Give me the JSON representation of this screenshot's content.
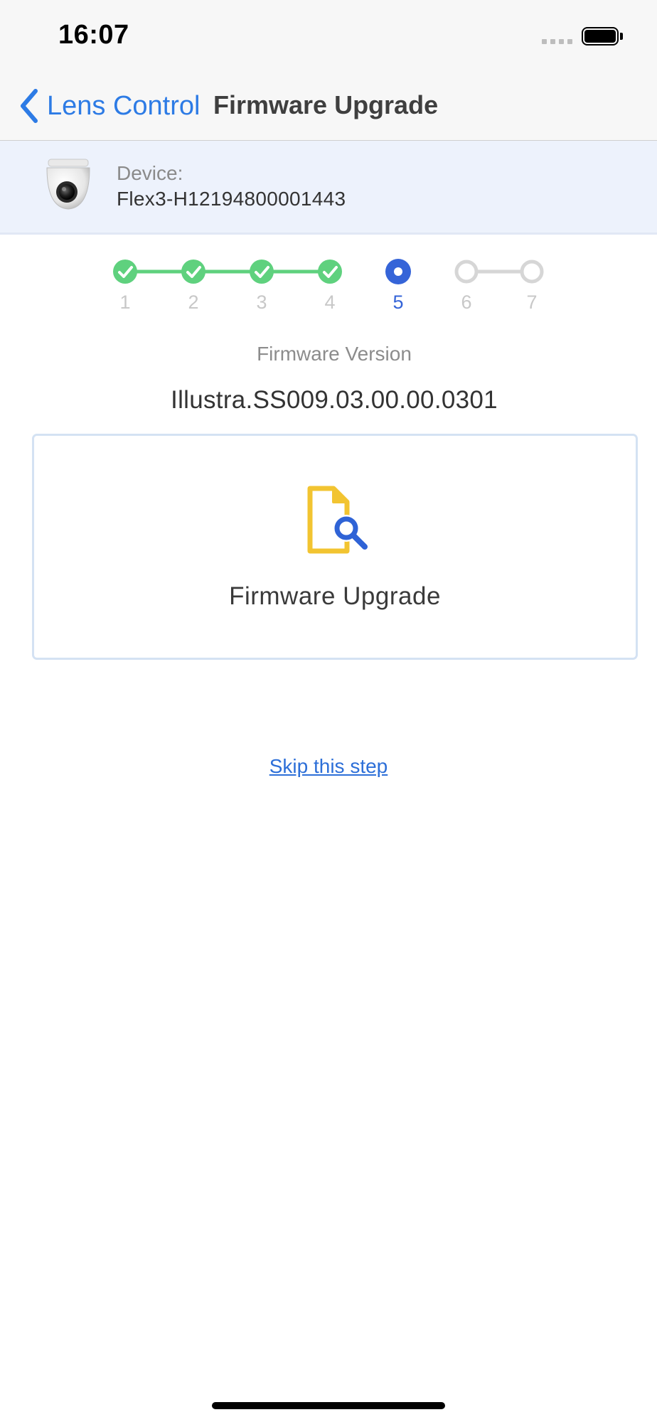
{
  "status_bar": {
    "time": "16:07",
    "battery_level": 1.0
  },
  "nav": {
    "back_label": "Lens Control",
    "title": "Firmware Upgrade",
    "back_icon": "chevron-left-icon"
  },
  "device": {
    "label": "Device:",
    "name": "Flex3-H12194800001443",
    "thumbnail_icon": "dome-camera-icon"
  },
  "stepper": {
    "current_step": 5,
    "steps": [
      {
        "label": "1",
        "state": "complete"
      },
      {
        "label": "2",
        "state": "complete"
      },
      {
        "label": "3",
        "state": "complete"
      },
      {
        "label": "4",
        "state": "complete"
      },
      {
        "label": "5",
        "state": "current"
      },
      {
        "label": "6",
        "state": "pending"
      },
      {
        "label": "7",
        "state": "pending"
      }
    ]
  },
  "firmware": {
    "caption": "Firmware Version",
    "version": "Illustra.SS009.03.00.00.0301"
  },
  "card": {
    "label": "Firmware Upgrade",
    "icon": "file-search-icon"
  },
  "skip_label": "Skip this step",
  "colors": {
    "accent_blue": "#3564d8",
    "link_blue": "#2d7be5",
    "complete_green": "#5fd17e",
    "pending_gray": "#d6d6d6",
    "file_icon_yellow": "#f2c431",
    "banner_bg": "#edf2fc"
  }
}
